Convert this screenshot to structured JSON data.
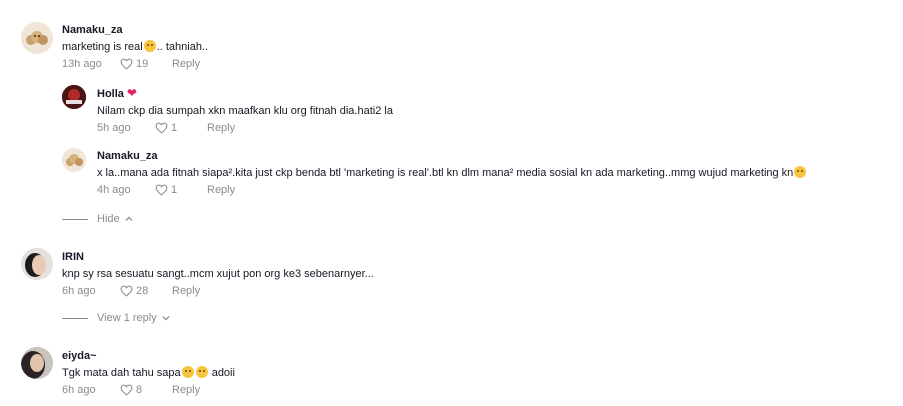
{
  "comments": [
    {
      "username": "Namaku_za",
      "text_before": "marketing is real",
      "text_after": ".. tahniah..",
      "time": "13h ago",
      "likes": "19",
      "reply": "Reply",
      "replies": [
        {
          "username": "Holla",
          "text": "Nilam ckp dia sumpah xkn maafkan klu org fitnah dia.hati2 la",
          "time": "5h ago",
          "likes": "1",
          "reply": "Reply"
        },
        {
          "username": "Namaku_za",
          "text": "x la..mana ada fitnah siapa².kita just ckp benda btl 'marketing is real'.btl kn dlm mana² media sosial kn ada marketing..mmg wujud marketing kn",
          "time": "4h ago",
          "likes": "1",
          "reply": "Reply"
        }
      ],
      "toggle": "Hide"
    },
    {
      "username": "IRIN",
      "text": "knp sy rsa sesuatu sangt..mcm xujut pon org ke3 sebenarnyer...",
      "time": "6h ago",
      "likes": "28",
      "reply": "Reply",
      "toggle": "View 1 reply"
    },
    {
      "username": "eiyda~",
      "text_before": "Tgk mata dah tahu sapa",
      "text_after": " adoii",
      "time": "6h ago",
      "likes": "8",
      "reply": "Reply"
    }
  ],
  "colors": {
    "text": "#161823",
    "muted": "#8a8b91",
    "heart_red": "#e0245e",
    "emoji": "#f6c43d"
  }
}
